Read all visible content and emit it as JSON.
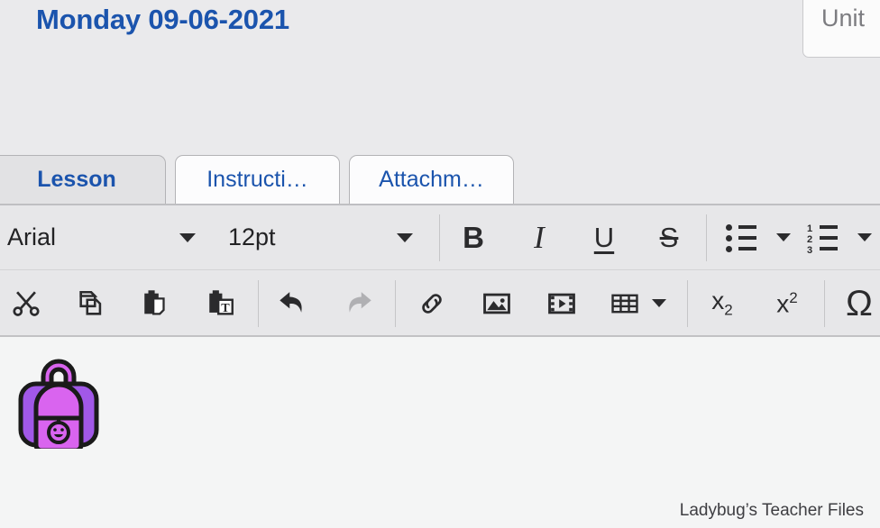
{
  "header": {
    "page_title": "Monday 09-06-2021",
    "title_color": "#1b54ad",
    "unit_button_label": "Unit"
  },
  "tabs": [
    {
      "label": "Lesson",
      "active": true
    },
    {
      "label": "Instructi…",
      "active": false
    },
    {
      "label": "Attachm…",
      "active": false
    }
  ],
  "toolbar_row1": {
    "font_family": {
      "value": "Arial",
      "icon": "chevron-down-icon"
    },
    "font_size": {
      "value": "12pt",
      "icon": "chevron-down-icon"
    },
    "bold": {
      "label": "B",
      "icon": "bold-icon"
    },
    "italic": {
      "label": "I",
      "icon": "italic-icon"
    },
    "underline": {
      "label": "U",
      "icon": "underline-icon"
    },
    "strikethrough": {
      "label": "S",
      "icon": "strikethrough-icon"
    },
    "bulleted_list": {
      "icon": "bulleted-list-icon"
    },
    "bulleted_list_more": {
      "icon": "chevron-down-icon"
    },
    "numbered_list": {
      "icon": "numbered-list-icon",
      "numbers": [
        "1",
        "2",
        "3"
      ]
    },
    "numbered_list_more": {
      "icon": "chevron-down-icon"
    }
  },
  "toolbar_row2": {
    "cut": {
      "icon": "scissors-icon"
    },
    "copy": {
      "icon": "copy-icon"
    },
    "paste": {
      "icon": "paste-icon"
    },
    "paste_as_text": {
      "icon": "paste-text-icon",
      "label": "T"
    },
    "undo": {
      "icon": "undo-arrow-icon",
      "enabled": true
    },
    "redo": {
      "icon": "redo-arrow-icon",
      "enabled": false
    },
    "link": {
      "icon": "link-icon"
    },
    "image": {
      "icon": "image-icon"
    },
    "video": {
      "icon": "video-icon"
    },
    "table": {
      "icon": "table-icon"
    },
    "table_more": {
      "icon": "chevron-down-icon"
    },
    "subscript": {
      "label": "x",
      "sub": "2",
      "icon": "subscript-icon"
    },
    "superscript": {
      "label": "x",
      "sup": "2",
      "icon": "superscript-icon"
    },
    "special_character": {
      "label": "Ω",
      "icon": "omega-icon"
    }
  },
  "content": {
    "backpack_emoji": "backpack-image",
    "backpack_colors": {
      "body": "#a158e8",
      "front": "#d964ef",
      "outline": "#1a1a1a"
    },
    "watermark": "Ladybug’s Teacher Files"
  },
  "colors": {
    "page_background": "#eaeaec",
    "toolbar_background": "#e7e7e9",
    "content_background": "#f4f5f5",
    "tab_active_background": "#e2e2e4",
    "tab_inactive_background": "#fcfcfd",
    "accent_blue": "#1b54ad"
  }
}
